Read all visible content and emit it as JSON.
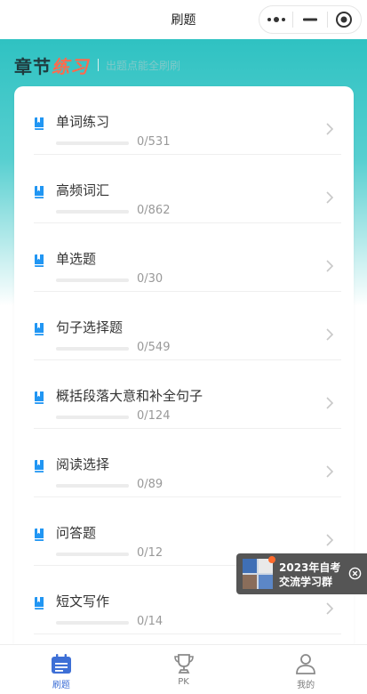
{
  "nav": {
    "title": "刷题"
  },
  "hero": {
    "title_part1": "章节",
    "title_part2": "练习",
    "subtitle": "出题点能全刷刷",
    "accent_color": "#ff6a4d",
    "theme_color": "#2fc2c2"
  },
  "chapters": [
    {
      "name": "单词练习",
      "progress_text": "0/531",
      "progress": 0
    },
    {
      "name": "高频词汇",
      "progress_text": "0/862",
      "progress": 0
    },
    {
      "name": "单选题",
      "progress_text": "0/30",
      "progress": 0
    },
    {
      "name": "句子选择题",
      "progress_text": "0/549",
      "progress": 0
    },
    {
      "name": "概括段落大意和补全句子",
      "progress_text": "0/124",
      "progress": 0
    },
    {
      "name": "阅读选择",
      "progress_text": "0/89",
      "progress": 0
    },
    {
      "name": "问答题",
      "progress_text": "0/12",
      "progress": 0
    },
    {
      "name": "短文写作",
      "progress_text": "0/14",
      "progress": 0
    }
  ],
  "promo": {
    "line1": "2023年自考",
    "line2": "交流学习群"
  },
  "tabbar": {
    "items": [
      {
        "label": "刷题",
        "icon": "calendar-icon",
        "active": true
      },
      {
        "label": "PK",
        "icon": "trophy-icon",
        "active": false
      },
      {
        "label": "我的",
        "icon": "user-icon",
        "active": false
      }
    ],
    "active_color": "#3d6fd6"
  }
}
